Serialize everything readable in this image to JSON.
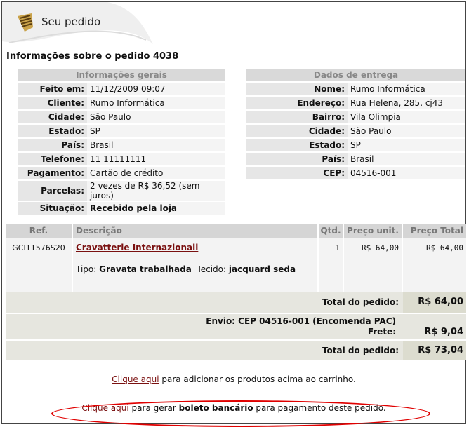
{
  "header": {
    "title": "Seu pedido"
  },
  "order": {
    "heading": "Informações sobre o pedido 4038"
  },
  "general": {
    "title": "Informações gerais",
    "rows": [
      {
        "label": "Feito em:",
        "value": "11/12/2009 09:07"
      },
      {
        "label": "Cliente:",
        "value": "Rumo Informática"
      },
      {
        "label": "Cidade:",
        "value": "São Paulo"
      },
      {
        "label": "Estado:",
        "value": "SP"
      },
      {
        "label": "País:",
        "value": "Brasil"
      },
      {
        "label": "Telefone:",
        "value": "11 11111111"
      },
      {
        "label": "Pagamento:",
        "value": "Cartão de crédito"
      },
      {
        "label": "Parcelas:",
        "value": "2 vezes de R$ 36,52 (sem juros)"
      },
      {
        "label": "Situação:",
        "value": "Recebido pela loja"
      }
    ]
  },
  "delivery": {
    "title": "Dados de entrega",
    "rows": [
      {
        "label": "Nome:",
        "value": "Rumo Informática"
      },
      {
        "label": "Endereço:",
        "value": "Rua Helena, 285. cj43"
      },
      {
        "label": "Bairro:",
        "value": "Vila Olimpia"
      },
      {
        "label": "Cidade:",
        "value": "São Paulo"
      },
      {
        "label": "Estado:",
        "value": "SP"
      },
      {
        "label": "País:",
        "value": "Brasil"
      },
      {
        "label": "CEP:",
        "value": "04516-001"
      }
    ]
  },
  "items": {
    "headers": {
      "ref": "Ref.",
      "desc": "Descrição",
      "qty": "Qtd.",
      "unit": "Preço unit.",
      "total": "Preço Total"
    },
    "rows": [
      {
        "ref": "GCI11576S20",
        "name": "Cravatterie Internazionali",
        "tipo_label": "Tipo:",
        "tipo_value": "Gravata trabalhada",
        "tecido_label": "Tecido:",
        "tecido_value": "jacquard seda",
        "qty": "1",
        "unit": "R$ 64,00",
        "total": "R$ 64,00"
      }
    ]
  },
  "totals": {
    "subtotal_label": "Total do pedido:",
    "subtotal_value": "R$ 64,00",
    "shipping_line": "Envio: CEP 04516-001 (Encomenda PAC)",
    "freight_label": "Frete:",
    "freight_value": "R$ 9,04",
    "total_label": "Total do pedido:",
    "total_value": "R$ 73,04"
  },
  "cart_msg": {
    "link": "Clique aqui",
    "text": " para adicionar os produtos acima ao carrinho."
  },
  "boleto_msg": {
    "link": "Clique aqui",
    "pre": " para gerar ",
    "bold": "boleto bancário",
    "post": " para pagamento deste pedido."
  },
  "colors": {
    "accent_link": "#7a1010",
    "highlight_ellipse": "#e00000"
  }
}
